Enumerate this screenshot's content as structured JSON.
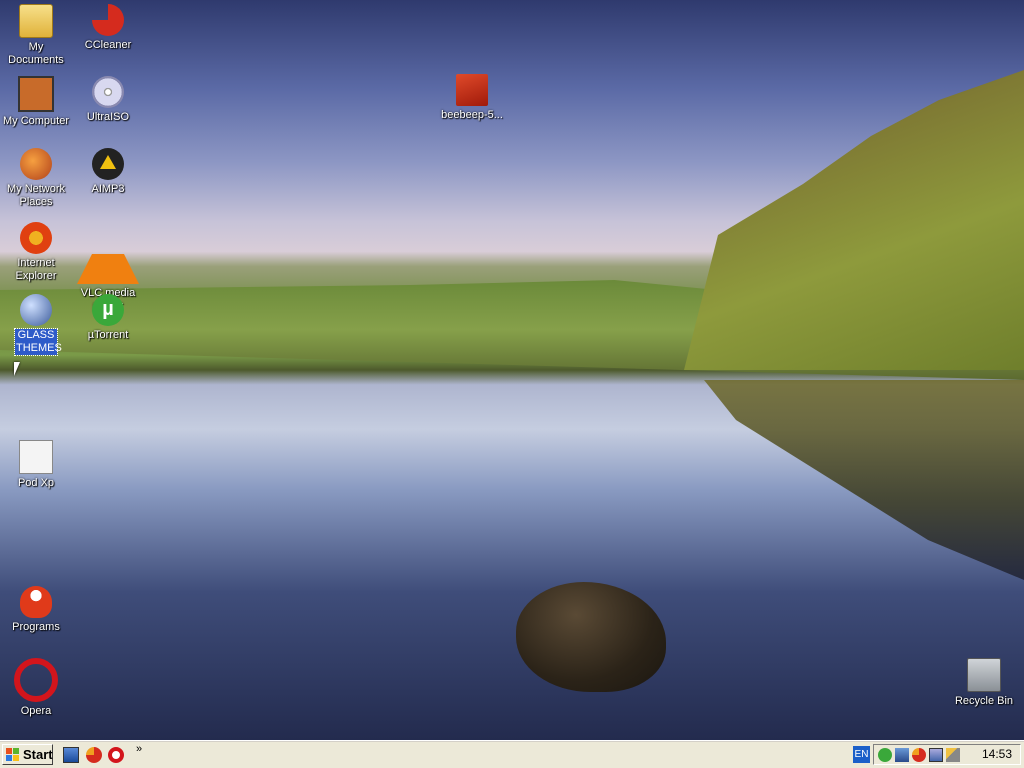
{
  "desktop": {
    "icons": [
      {
        "label": "My Documents",
        "icon": "folder-icon"
      },
      {
        "label": "CCleaner",
        "icon": "ccleaner-icon"
      },
      {
        "label": "My Computer",
        "icon": "computer-icon"
      },
      {
        "label": "UltraISO",
        "icon": "disc-icon"
      },
      {
        "label": "My Network Places",
        "icon": "network-icon"
      },
      {
        "label": "AIMP3",
        "icon": "aimp-icon"
      },
      {
        "label": "Internet Explorer",
        "icon": "ie-icon"
      },
      {
        "label": "VLC media player",
        "icon": "vlc-icon"
      },
      {
        "label": "GLASS THEMES",
        "icon": "glass-themes-icon"
      },
      {
        "label": "µTorrent",
        "icon": "utorrent-icon"
      },
      {
        "label": "Pod Xp",
        "icon": "document-icon"
      },
      {
        "label": "Programs",
        "icon": "programs-icon"
      },
      {
        "label": "Opera",
        "icon": "opera-icon"
      },
      {
        "label": "beebeep-5...",
        "icon": "beebeep-icon"
      },
      {
        "label": "Recycle Bin",
        "icon": "recycle-bin-icon"
      }
    ]
  },
  "taskbar": {
    "start_label": "Start",
    "quick_launch_chevron": "»",
    "language": "EN",
    "clock": "14:53"
  },
  "colors": {
    "taskbar_bg": "#ece9d8",
    "selection": "#2e5bc9",
    "lang_indicator": "#1b5fc9"
  }
}
